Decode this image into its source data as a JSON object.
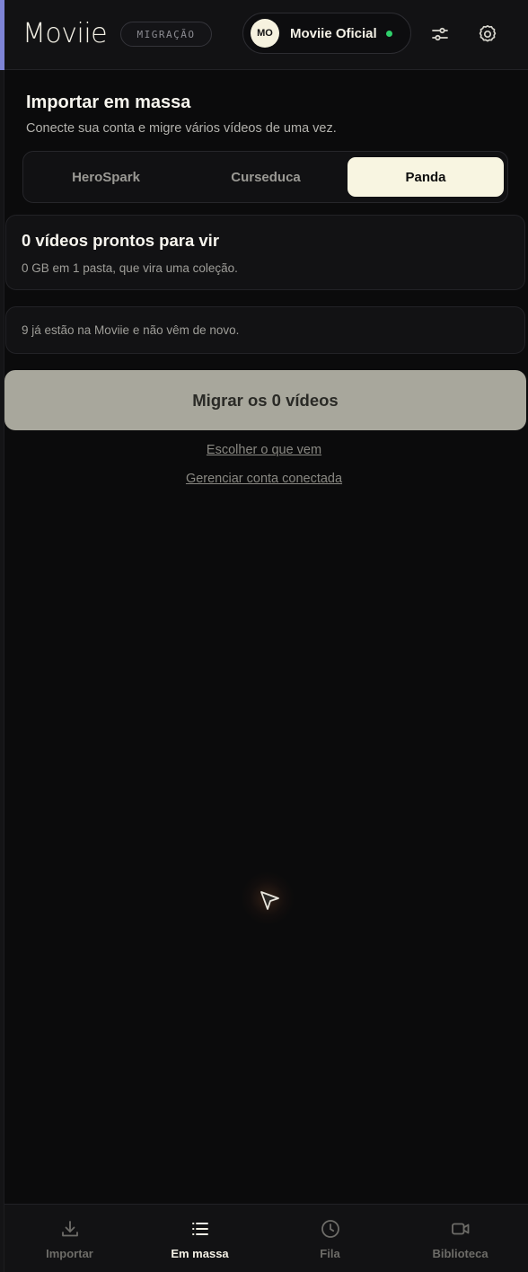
{
  "header": {
    "logo_text": "Moviie",
    "mode_tag": "MIGRAÇÃO",
    "account": {
      "initials": "MO",
      "name": "Moviie Oficial",
      "status_color": "#2fd06b"
    },
    "icons": [
      "sliders-icon",
      "gear-icon"
    ]
  },
  "main": {
    "title": "Importar em massa",
    "subtitle": "Conecte sua conta e migre vários vídeos de uma vez.",
    "sources": [
      {
        "label": "HeroSpark",
        "active": false
      },
      {
        "label": "Curseduca",
        "active": false
      },
      {
        "label": "Panda",
        "active": true
      }
    ],
    "ready_card": {
      "heading": "0 vídeos prontos para vir",
      "detail": "0 GB em 1 pasta, que vira uma coleção."
    },
    "note": "9 já estão na Moviie e não vêm de novo.",
    "migrate_button": "Migrar os 0 vídeos",
    "link_choose": "Escolher o que vem",
    "link_manage": "Gerenciar conta conectada"
  },
  "bottom_nav": [
    {
      "label": "Importar",
      "icon": "download-icon",
      "active": false
    },
    {
      "label": "Em massa",
      "icon": "list-icon",
      "active": true
    },
    {
      "label": "Fila",
      "icon": "clock-icon",
      "active": false
    },
    {
      "label": "Biblioteca",
      "icon": "video-camera-icon",
      "active": false
    }
  ],
  "colors": {
    "background": "#0b0b0c",
    "accent_cream": "#f8f5e1",
    "button_disabled": "#a8a79c",
    "online": "#2fd06b"
  }
}
